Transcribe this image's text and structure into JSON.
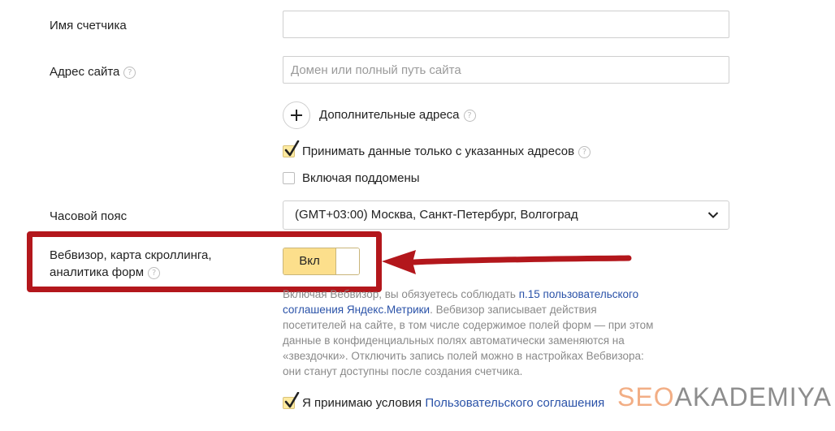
{
  "counter_name": {
    "label": "Имя счетчика",
    "value": ""
  },
  "site_address": {
    "label": "Адрес сайта",
    "help": "?",
    "placeholder": "Домен или полный путь сайта",
    "value": ""
  },
  "additional_addresses": {
    "label": "Дополнительные адреса",
    "help": "?"
  },
  "accept_only_specified": {
    "label": "Принимать данные только с указанных адресов",
    "help": "?",
    "checked": true
  },
  "include_subdomains": {
    "label": "Включая поддомены",
    "checked": false
  },
  "timezone": {
    "label": "Часовой пояс",
    "value": "(GMT+03:00) Москва, Санкт-Петербург, Волгоград"
  },
  "webvisor": {
    "label_line1": "Вебвизор, карта скроллинга,",
    "label_line2": "аналитика форм",
    "help": "?",
    "toggle_label": "Вкл",
    "enabled": true
  },
  "webvisor_description": {
    "part1": "Включая Вебвизор, вы обязуетесь соблюдать ",
    "link1": "п.15 пользовательского",
    "link2": "соглашения Яндекс.Метрики",
    "part2": ". Вебвизор записывает действия",
    "line3": "посетителей на сайте, в том числе содержимое полей форм — при этом",
    "line4": "данные в конфиденциальных полях автоматически заменяются на",
    "line5": "«звездочки». Отключить запись полей можно в настройках Вебвизора:",
    "line6": "они станут доступны после создания счетчика."
  },
  "terms": {
    "prefix": "Я принимаю условия ",
    "link": "Пользовательского соглашения",
    "checked": true
  },
  "watermark": {
    "part1": "SEO",
    "part2": "AKADEMIYA"
  },
  "colors": {
    "accent_yellow": "#fcdf8c",
    "highlight_red": "#b3171c",
    "link_blue": "#2a52a8"
  }
}
